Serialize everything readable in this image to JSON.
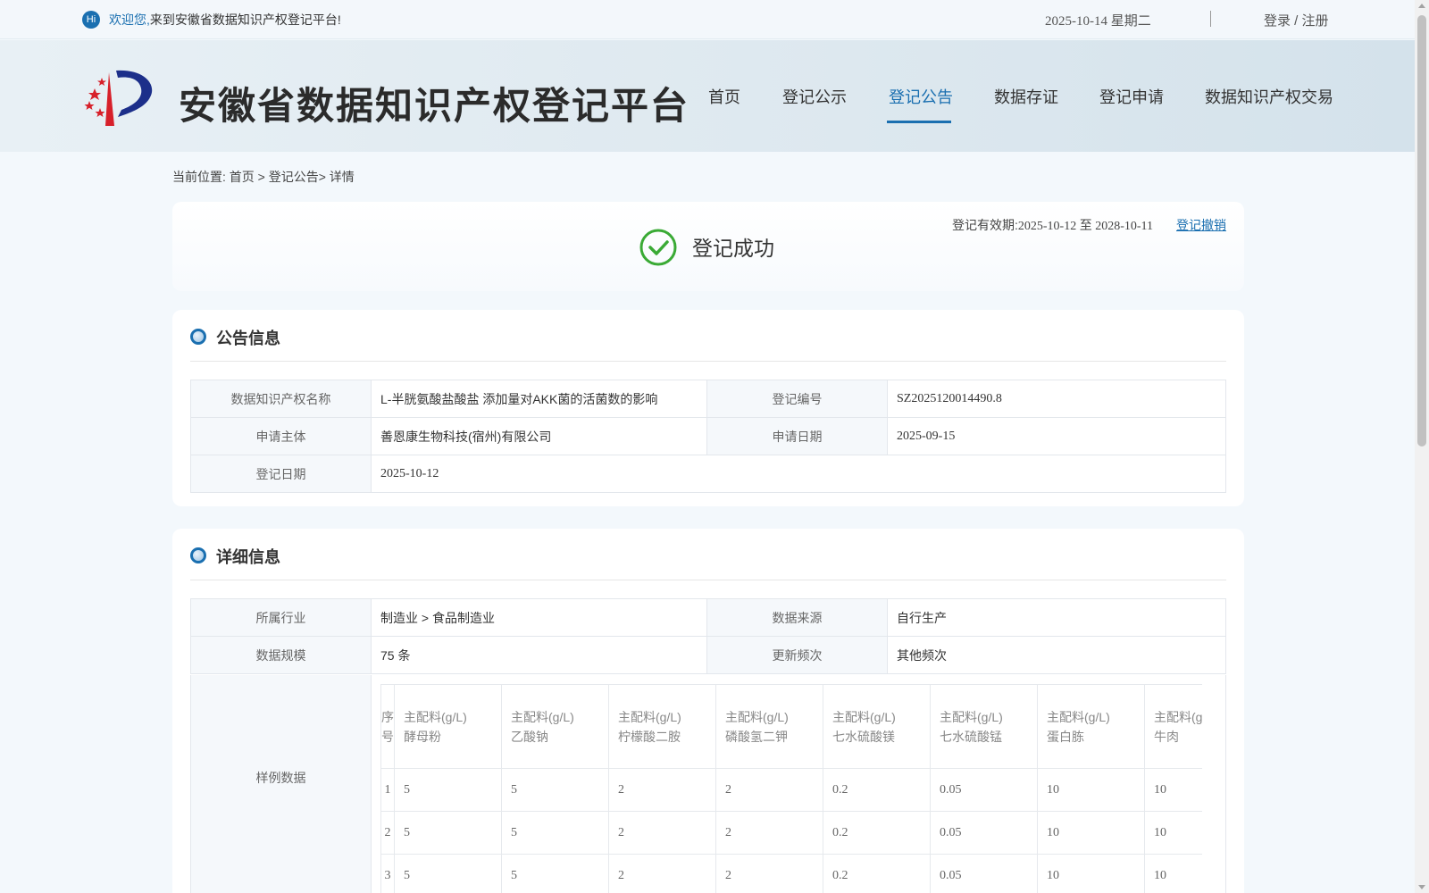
{
  "topbar": {
    "hi_icon": "Hi",
    "welcome_prefix": "欢迎您,",
    "welcome_text": "来到安徽省数据知识产权登记平台!",
    "date": "2025-10-14 星期二",
    "login_label": "登录 / 注册"
  },
  "header": {
    "site_title": "安徽省数据知识产权登记平台",
    "nav": [
      {
        "label": "首页",
        "active": false
      },
      {
        "label": "登记公示",
        "active": false
      },
      {
        "label": "登记公告",
        "active": true
      },
      {
        "label": "数据存证",
        "active": false
      },
      {
        "label": "登记申请",
        "active": false
      },
      {
        "label": "数据知识产权交易",
        "active": false
      }
    ]
  },
  "breadcrumb": "当前位置: 首页 > 登记公告> 详情",
  "status": {
    "text": "登记成功",
    "validity_label": "登记有效期:",
    "validity_range": "2025-10-12 至 2028-10-11",
    "revoke_link": "登记撤销"
  },
  "announcement": {
    "title": "公告信息",
    "name_label": "数据知识产权名称",
    "name_value": "L-半胱氨酸盐酸盐 添加量对AKK菌的活菌数的影响",
    "reg_no_label": "登记编号",
    "reg_no_value": "SZ2025120014490.8",
    "applicant_label": "申请主体",
    "applicant_value": "善恩康生物科技(宿州)有限公司",
    "apply_date_label": "申请日期",
    "apply_date_value": "2025-09-15",
    "reg_date_label": "登记日期",
    "reg_date_value": "2025-10-12"
  },
  "details": {
    "title": "详细信息",
    "industry_label": "所属行业",
    "industry_value": "制造业 > 食品制造业",
    "source_label": "数据来源",
    "source_value": "自行生产",
    "scale_label": "数据规模",
    "scale_value": "75 条",
    "frequency_label": "更新频次",
    "frequency_value": "其他频次",
    "sample_label": "样例数据",
    "sample_table": {
      "index_header": "序号",
      "columns": [
        {
          "line1": "主配料(g/L)",
          "line2": "酵母粉"
        },
        {
          "line1": "主配料(g/L)",
          "line2": "乙酸钠"
        },
        {
          "line1": "主配料(g/L)",
          "line2": "柠檬酸二胺"
        },
        {
          "line1": "主配料(g/L)",
          "line2": "磷酸氢二钾"
        },
        {
          "line1": "主配料(g/L)",
          "line2": "七水硫酸镁"
        },
        {
          "line1": "主配料(g/L)",
          "line2": "七水硫酸锰"
        },
        {
          "line1": "主配料(g/L)",
          "line2": "蛋白胨"
        },
        {
          "line1": "主配料(g/L)",
          "line2": "牛肉"
        }
      ],
      "rows": [
        {
          "idx": "1",
          "values": [
            "5",
            "5",
            "2",
            "2",
            "0.2",
            "0.05",
            "10",
            "10"
          ]
        },
        {
          "idx": "2",
          "values": [
            "5",
            "5",
            "2",
            "2",
            "0.2",
            "0.05",
            "10",
            "10"
          ]
        },
        {
          "idx": "3",
          "values": [
            "5",
            "5",
            "2",
            "2",
            "0.2",
            "0.05",
            "10",
            "10"
          ]
        }
      ]
    }
  },
  "colors": {
    "accent": "#1a6fb0",
    "success": "#3aaa35",
    "logo_red": "#d7202a",
    "logo_blue": "#1c2f8a"
  }
}
